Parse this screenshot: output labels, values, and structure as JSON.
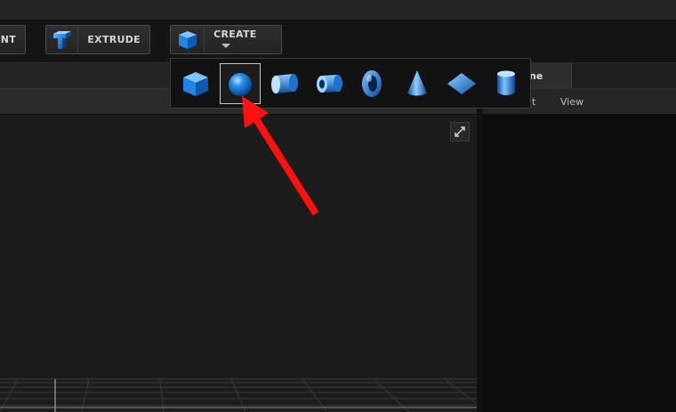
{
  "toolbar": {
    "buttons": [
      {
        "label": "ENT",
        "icon": "partial-tool-icon"
      },
      {
        "label": "EXTRUDE",
        "icon": "extrude-icon"
      },
      {
        "label": "CREATE",
        "icon": "cube-icon"
      }
    ]
  },
  "create_menu": {
    "shapes": [
      {
        "name": "cube",
        "icon": "cube-shape-icon"
      },
      {
        "name": "sphere",
        "icon": "sphere-shape-icon",
        "selected": true
      },
      {
        "name": "cylinder",
        "icon": "cylinder-shape-icon"
      },
      {
        "name": "tube",
        "icon": "tube-shape-icon"
      },
      {
        "name": "torus",
        "icon": "torus-shape-icon"
      },
      {
        "name": "cone",
        "icon": "cone-shape-icon"
      },
      {
        "name": "plane",
        "icon": "plane-shape-icon"
      },
      {
        "name": "capsule",
        "icon": "capsule-shape-icon"
      }
    ]
  },
  "right_panel": {
    "tab_label": "ne",
    "menu": [
      "dit",
      "View"
    ]
  },
  "annotation": {
    "arrow_color": "#ff1010",
    "arrow_target": "sphere-shape-button"
  },
  "colors": {
    "shape_blue": "#1f86e6",
    "background": "#1b1b1b"
  }
}
